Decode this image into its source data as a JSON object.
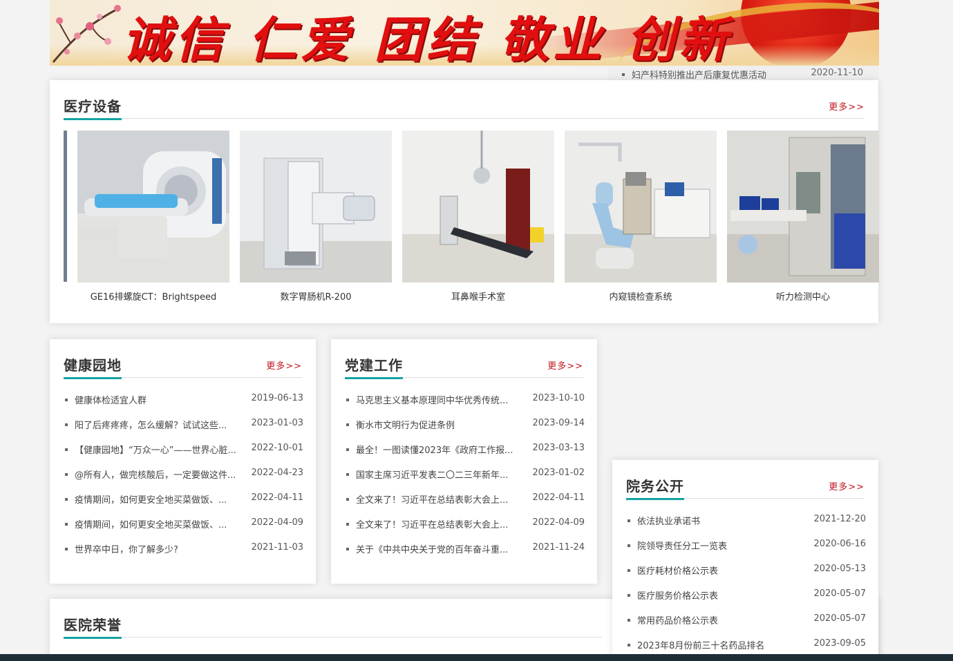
{
  "banner": {
    "slogan": "诚信 仁爱 团结 敬业 创新"
  },
  "ticker": {
    "item": "妇产科特别推出产后康复优惠活动",
    "date": "2020-11-10"
  },
  "equipment": {
    "title": "医疗设备",
    "more": "更多>>",
    "items": [
      {
        "caption": "GE16排螺旋CT：Brightspeed"
      },
      {
        "caption": "数字胃肠机R-200"
      },
      {
        "caption": "耳鼻喉手术室"
      },
      {
        "caption": "内窥镜检查系统"
      },
      {
        "caption": "听力检测中心"
      }
    ]
  },
  "health": {
    "title": "健康园地",
    "more": "更多>>",
    "rows": [
      {
        "title": "健康体检适宜人群",
        "date": "2019-06-13"
      },
      {
        "title": "阳了后疼疼疼，怎么缓解？试试这些...",
        "date": "2023-01-03"
      },
      {
        "title": "【健康园地】“万众一心”——世界心脏...",
        "date": "2022-10-01"
      },
      {
        "title": "@所有人，做完核酸后，一定要做这件...",
        "date": "2022-04-23"
      },
      {
        "title": "疫情期间，如何更安全地买菜做饭、...",
        "date": "2022-04-11"
      },
      {
        "title": "疫情期间，如何更安全地买菜做饭、...",
        "date": "2022-04-09"
      },
      {
        "title": "世界卒中日，你了解多少?",
        "date": "2021-11-03"
      }
    ]
  },
  "party": {
    "title": "党建工作",
    "more": "更多>>",
    "rows": [
      {
        "title": "马克思主义基本原理同中华优秀传统...",
        "date": "2023-10-10"
      },
      {
        "title": "衡水市文明行为促进条例",
        "date": "2023-09-14"
      },
      {
        "title": "最全！一图读懂2023年《政府工作报...",
        "date": "2023-03-13"
      },
      {
        "title": "国家主席习近平发表二〇二三年新年...",
        "date": "2023-01-02"
      },
      {
        "title": "全文来了！习近平在总结表彰大会上...",
        "date": "2022-04-11"
      },
      {
        "title": "全文来了！习近平在总结表彰大会上...",
        "date": "2022-04-09"
      },
      {
        "title": "关于《中共中央关于党的百年奋斗重...",
        "date": "2021-11-24"
      }
    ]
  },
  "affairs": {
    "title": "院务公开",
    "more": "更多>>",
    "rows": [
      {
        "title": "依法执业承诺书",
        "date": "2021-12-20"
      },
      {
        "title": "院领导责任分工一览表",
        "date": "2020-06-16"
      },
      {
        "title": "医疗耗材价格公示表",
        "date": "2020-05-13"
      },
      {
        "title": "医疗服务价格公示表",
        "date": "2020-05-07"
      },
      {
        "title": "常用药品价格公示表",
        "date": "2020-05-07"
      },
      {
        "title": "2023年8月份前三十名药品排名",
        "date": "2023-09-05"
      }
    ]
  },
  "honor": {
    "title": "医院荣誉"
  }
}
